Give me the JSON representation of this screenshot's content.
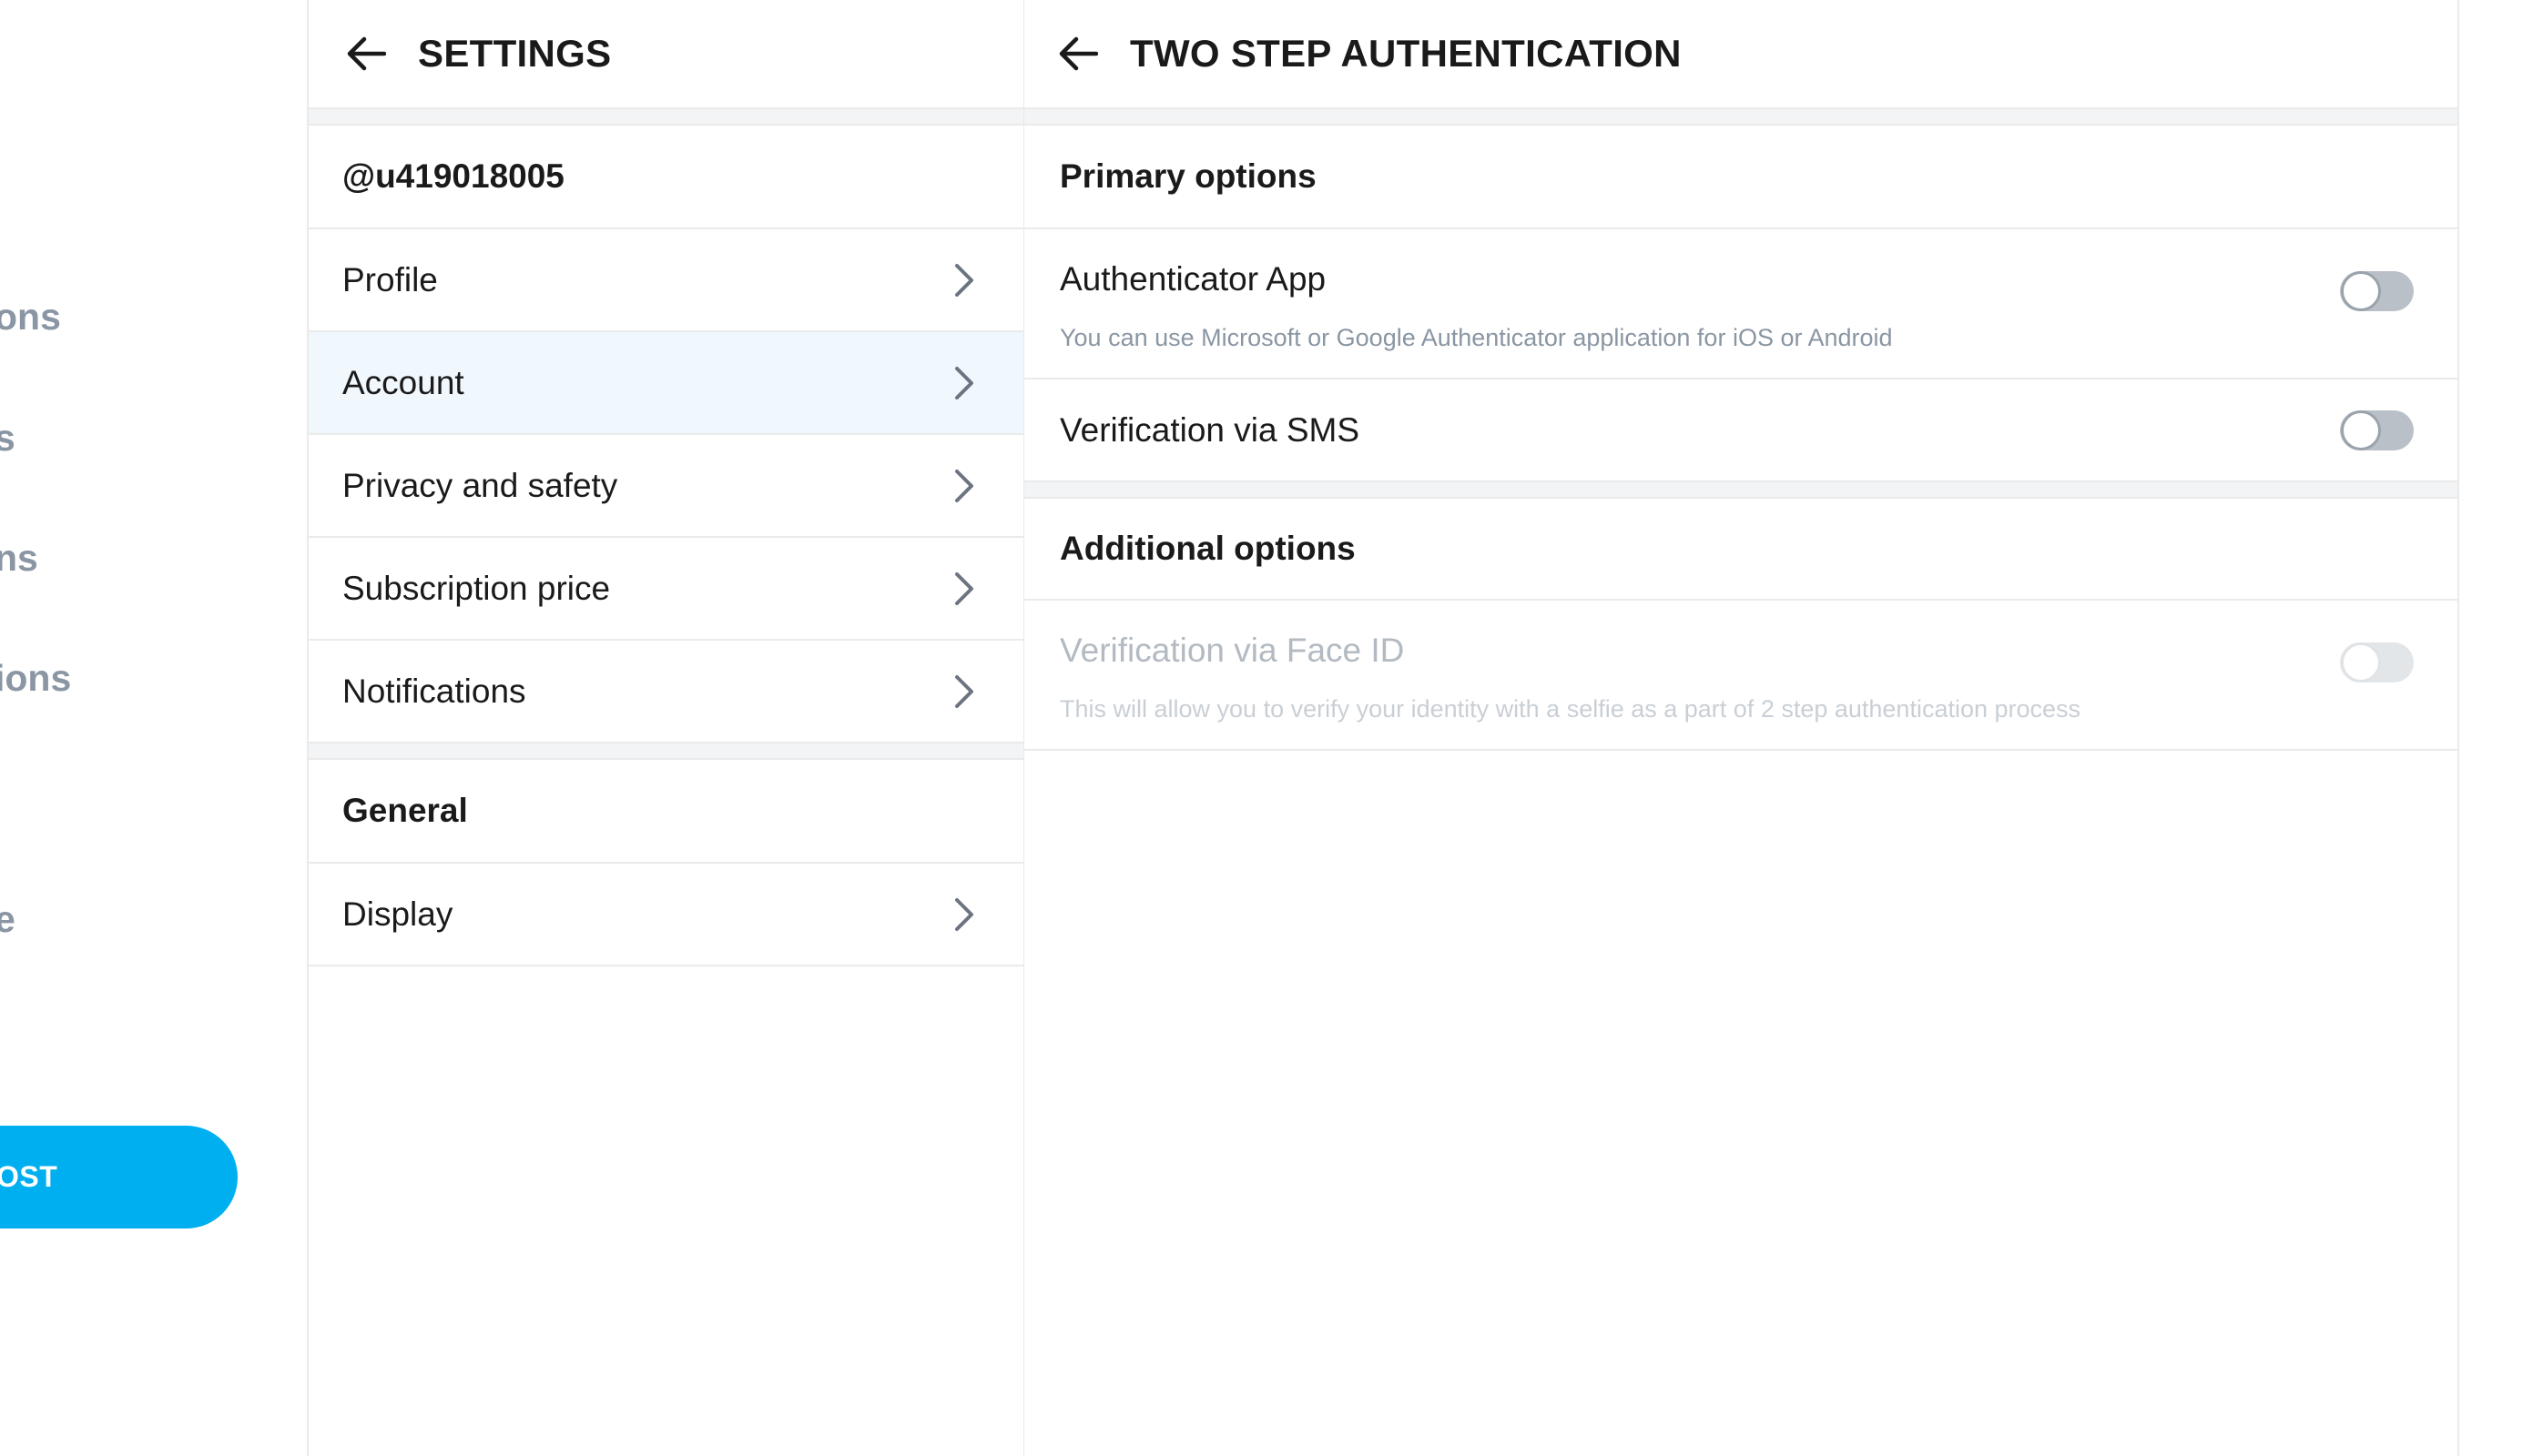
{
  "left_nav": {
    "items": [
      {
        "label": "ons"
      },
      {
        "label": "s"
      },
      {
        "label": "ns"
      },
      {
        "label": "ions"
      },
      {
        "label": "e"
      }
    ],
    "post_button_label": "OST"
  },
  "settings": {
    "title": "SETTINGS",
    "username": "@u419018005",
    "account_items": [
      {
        "label": "Profile"
      },
      {
        "label": "Account"
      },
      {
        "label": "Privacy and safety"
      },
      {
        "label": "Subscription price"
      },
      {
        "label": "Notifications"
      }
    ],
    "general_label": "General",
    "general_items": [
      {
        "label": "Display"
      }
    ]
  },
  "detail": {
    "title": "TWO STEP AUTHENTICATION",
    "primary_label": "Primary options",
    "primary_options": [
      {
        "title": "Authenticator App",
        "description": "You can use Microsoft or Google Authenticator application for iOS or Android",
        "enabled": false
      },
      {
        "title": "Verification via SMS",
        "enabled": false
      }
    ],
    "additional_label": "Additional options",
    "additional_options": [
      {
        "title": "Verification via Face ID",
        "description": "This will allow you to verify your identity with a selfie as a part of 2 step authentication process",
        "enabled": false,
        "disabled": true
      }
    ]
  },
  "colors": {
    "accent": "#00aff0",
    "active_row": "#f0f8fd",
    "muted_text": "#8a96a3"
  }
}
